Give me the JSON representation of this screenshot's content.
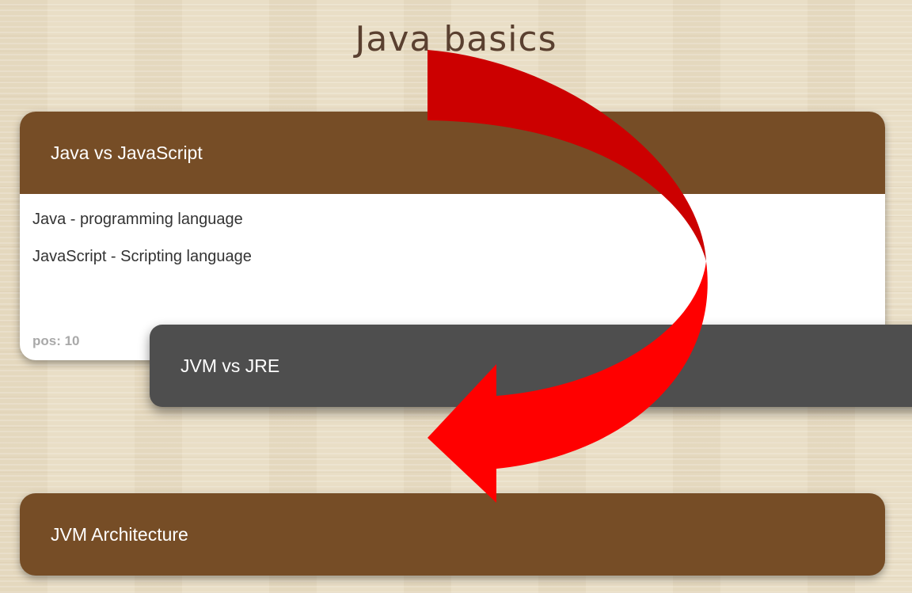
{
  "page": {
    "title": "Java basics"
  },
  "cards": [
    {
      "title": "Java vs JavaScript",
      "lines": [
        "Java - programming language",
        "JavaScript - Scripting language"
      ],
      "footer": "pos: 10",
      "state": "expanded",
      "header_color": "#764d26"
    },
    {
      "title": "JVM vs JRE",
      "state": "dragging",
      "header_color": "#4e4e4e"
    },
    {
      "title": "JVM Architecture",
      "state": "collapsed",
      "header_color": "#764d26"
    }
  ],
  "overlay": {
    "icon": "curved-arrow-icon",
    "color_dark": "#cc0000",
    "color_light": "#ff0000"
  }
}
